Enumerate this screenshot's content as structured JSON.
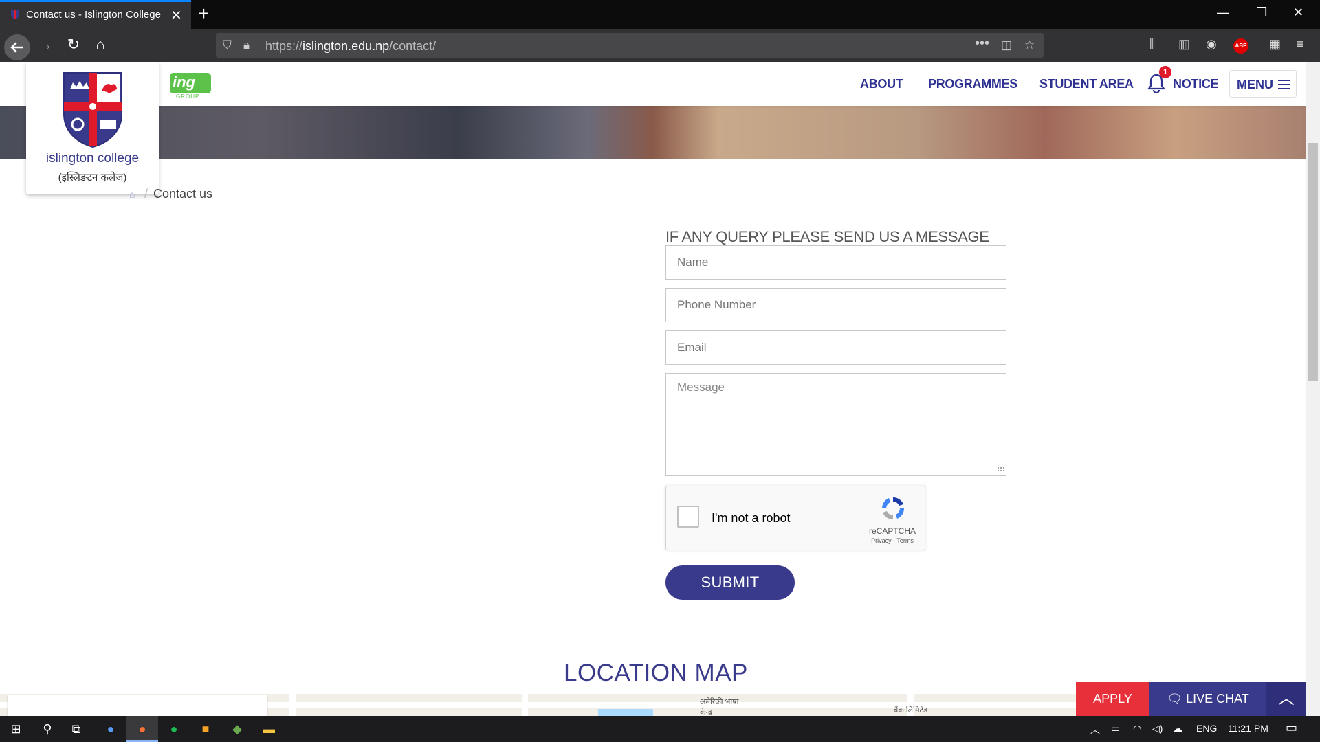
{
  "browser": {
    "tab_title": "Contact us - Islington College",
    "url_prefix": "https://",
    "url_host": "islington.edu.np",
    "url_path": "/contact/"
  },
  "header": {
    "logo_name": "islington college",
    "logo_sub": "(इस्लिङटन कलेज)",
    "ing_logo": "ing",
    "ing_sub": "GROUP",
    "nav": [
      "ABOUT",
      "PROGRAMMES",
      "STUDENT AREA"
    ],
    "notice_label": "NOTICE",
    "notice_count": "1",
    "menu_label": "MENU"
  },
  "breadcrumb": {
    "current": "Contact us"
  },
  "form": {
    "title": "IF ANY QUERY PLEASE SEND US A MESSAGE",
    "name_placeholder": "Name",
    "phone_placeholder": "Phone Number",
    "email_placeholder": "Email",
    "message_placeholder": "Message",
    "recaptcha_label": "I'm not a robot",
    "recaptcha_brand": "reCAPTCHA",
    "recaptcha_terms": "Privacy - Terms",
    "submit_label": "SUBMIT"
  },
  "location": {
    "title": "LOCATION MAP",
    "label_1": "अमेरिकी भाषा केन्द्र",
    "label_2": "बैंक लिमिटेड"
  },
  "floating": {
    "apply_label": "APPLY",
    "chat_label": "LIVE CHAT"
  },
  "taskbar": {
    "language": "ENG",
    "time": "11:21 PM"
  }
}
